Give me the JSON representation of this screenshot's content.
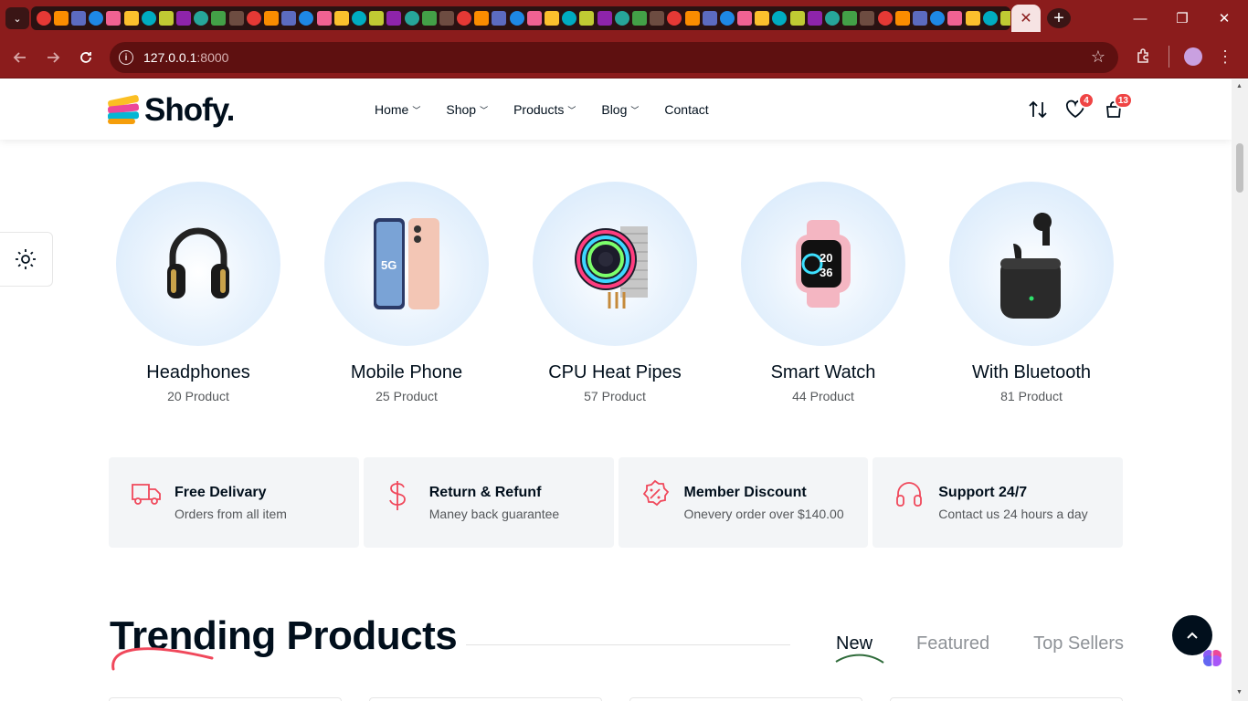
{
  "browser": {
    "tab_toggle": "⌄",
    "active_tab_close": "✕",
    "new_tab": "+",
    "window_controls": {
      "minimize": "—",
      "restore": "❐",
      "close": "✕"
    },
    "url_host": "127.0.0.1",
    "url_port": ":8000"
  },
  "site": {
    "logo_text": "Shofy.",
    "menu": [
      {
        "label": "Home",
        "has_dropdown": true
      },
      {
        "label": "Shop",
        "has_dropdown": true
      },
      {
        "label": "Products",
        "has_dropdown": true
      },
      {
        "label": "Blog",
        "has_dropdown": true
      },
      {
        "label": "Contact",
        "has_dropdown": false
      }
    ],
    "wishlist_count": "4",
    "cart_count": "13"
  },
  "categories": [
    {
      "name": "Headphones",
      "count": "20 Product",
      "icon": "headphones-image"
    },
    {
      "name": "Mobile Phone",
      "count": "25 Product",
      "icon": "phone-image"
    },
    {
      "name": "CPU Heat Pipes",
      "count": "57 Product",
      "icon": "cpu-cooler-image"
    },
    {
      "name": "Smart Watch",
      "count": "44 Product",
      "icon": "smartwatch-image"
    },
    {
      "name": "With Bluetooth",
      "count": "81 Product",
      "icon": "earbuds-image"
    }
  ],
  "features": [
    {
      "title": "Free Delivary",
      "subtitle": "Orders from all item",
      "icon": "truck-icon"
    },
    {
      "title": "Return & Refunf",
      "subtitle": "Maney back guarantee",
      "icon": "dollar-icon"
    },
    {
      "title": "Member Discount",
      "subtitle": "Onevery order over $140.00",
      "icon": "discount-badge-icon"
    },
    {
      "title": "Support 24/7",
      "subtitle": "Contact us 24 hours a day",
      "icon": "headset-icon"
    }
  ],
  "trending": {
    "title": "Trending Products",
    "tabs": [
      "New",
      "Featured",
      "Top Sellers"
    ],
    "active_tab": "New"
  },
  "colors": {
    "browser_frame": "#8b1c1c",
    "accent": "#f0485b",
    "text_dark": "#010f1c",
    "category_circle": "#d3e7fb",
    "badge": "#ef4444"
  }
}
